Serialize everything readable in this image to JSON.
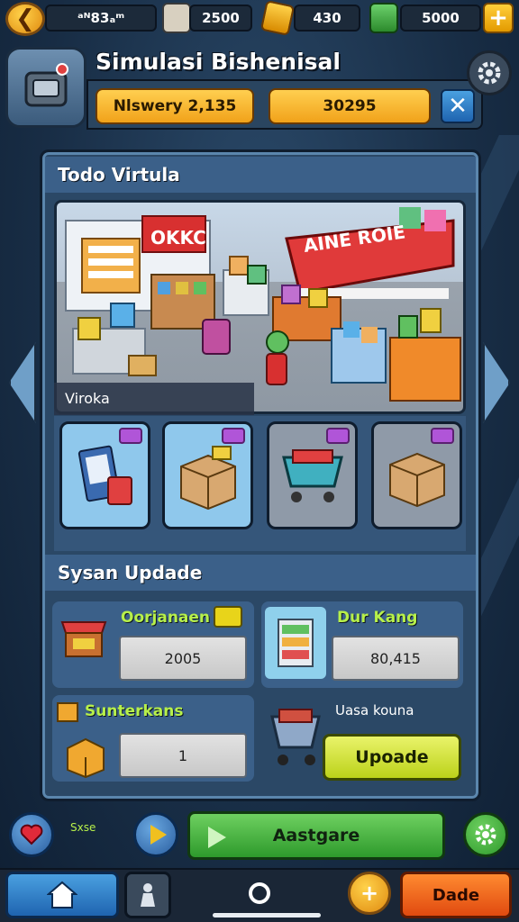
{
  "topbar": {
    "back_icon": "back-arrow-icon",
    "resources": [
      {
        "value": "Ʃ83₃₀ᵐ",
        "display": "ᵃᴺ83ₐᵐ",
        "icon": "wallet-icon"
      },
      {
        "value": "2500",
        "icon": "paint-bucket-icon"
      },
      {
        "value": "430",
        "icon": "gold-gem-icon"
      },
      {
        "value": "5000",
        "icon": "cash-stack-icon"
      }
    ],
    "plus_icon": "plus-icon"
  },
  "header": {
    "title": "Simulasi Bishenisal",
    "pill_left": "Nlswery 2,135",
    "pill_right": "30295",
    "close_icon": "close-icon",
    "settings_icon": "gear-icon",
    "avatar_icon": "cash-register-icon"
  },
  "section_store": {
    "title": "Todo Virtula",
    "scene_caption": "Viroka",
    "sign_left": "OKKC",
    "sign_right": "AINE ROIE",
    "items": [
      {
        "name": "card-pack-icon",
        "color": "#8fc8ec"
      },
      {
        "name": "boxes-icon",
        "color": "#8fc8ec"
      },
      {
        "name": "shopping-cart-icon",
        "color": "#8f9aa8"
      },
      {
        "name": "box-icon",
        "color": "#8f9aa8"
      }
    ]
  },
  "section_update": {
    "title": "Sysan Updade",
    "rows": [
      {
        "title": "Oorjanaen",
        "value": "2005",
        "icon": "shop-stall-icon"
      },
      {
        "title": "Dur Kang",
        "value": "80,415",
        "icon": "shelf-icon"
      },
      {
        "title": "Sunterkans",
        "value": "1",
        "icon": "package-icon"
      }
    ],
    "helper": "Uasa kouna",
    "update_label": "Upoade"
  },
  "bottom": {
    "small_label": "Sxse",
    "action_label": "Aastgare"
  },
  "navbar": {
    "right_label": "Dade"
  },
  "colors": {
    "accent_orange": "#f1a21a",
    "accent_green": "#2e9a2c",
    "accent_blue": "#1f64b0",
    "panel": "#2b4866"
  }
}
